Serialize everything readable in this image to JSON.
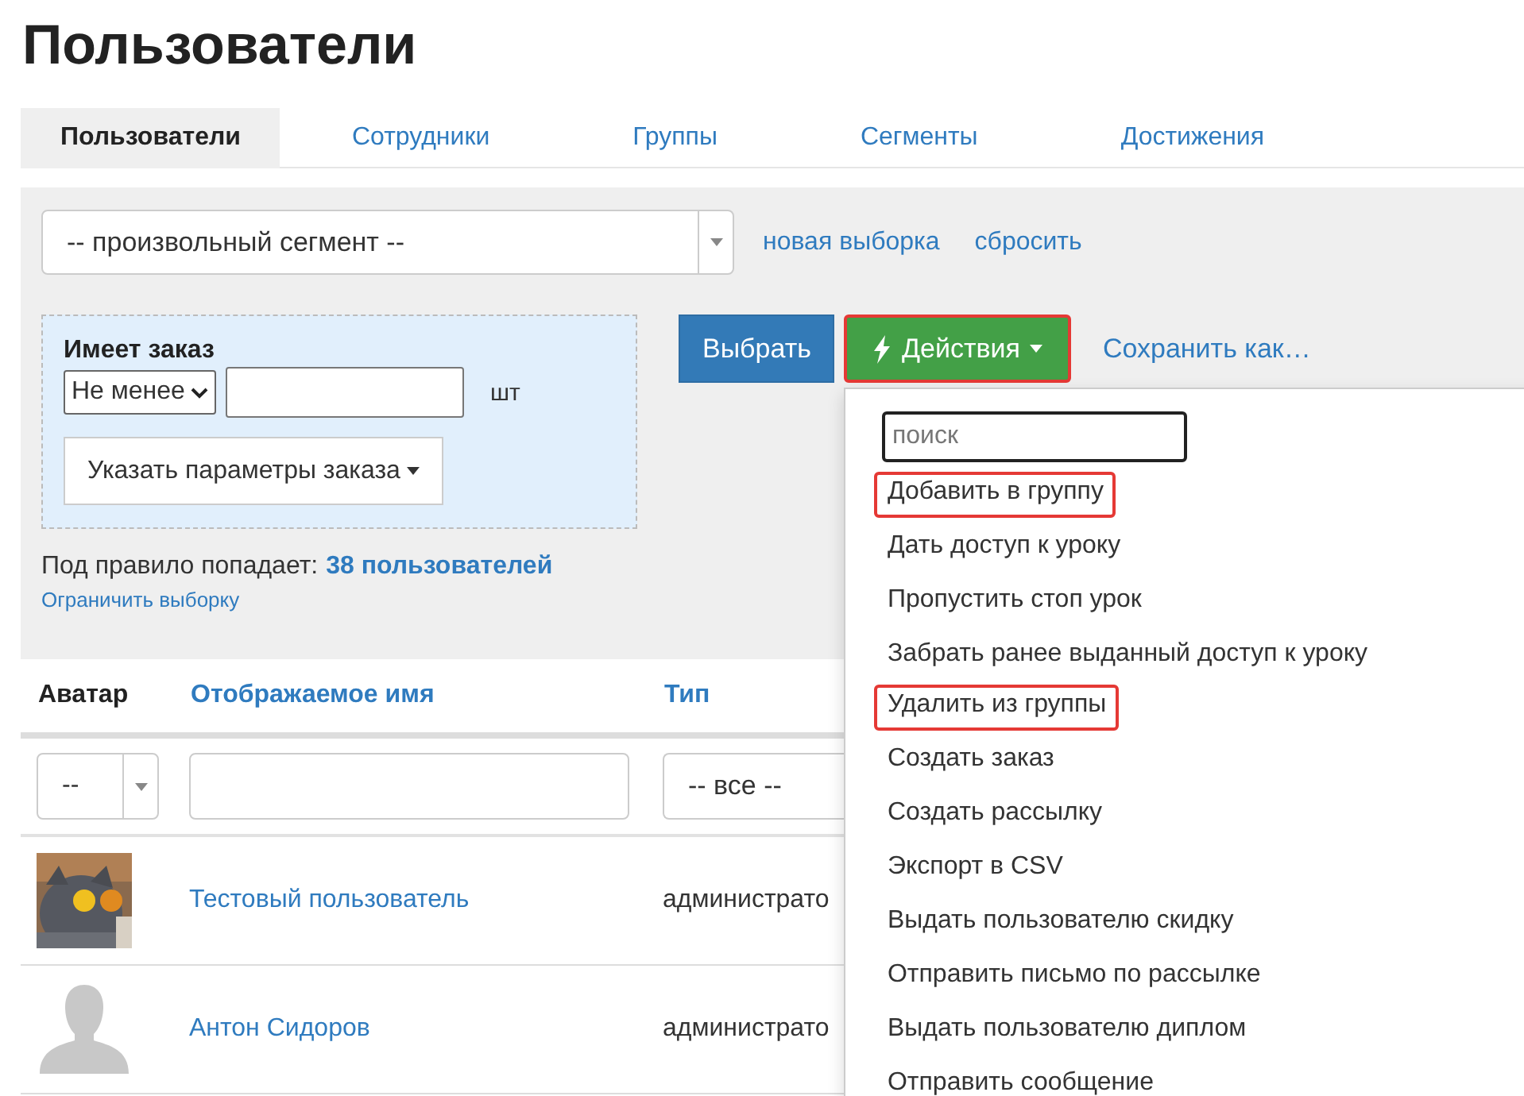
{
  "page_title": "Пользователи",
  "tabs": [
    {
      "label": "Пользователи",
      "selected": true
    },
    {
      "label": "Сотрудники",
      "selected": false
    },
    {
      "label": "Группы",
      "selected": false
    },
    {
      "label": "Сегменты",
      "selected": false
    },
    {
      "label": "Достижения",
      "selected": false
    }
  ],
  "segment_select": {
    "value": "-- произвольный сегмент --"
  },
  "segment_links": [
    "новая выборка",
    "сбросить"
  ],
  "filter": {
    "title": "Имеет заказ",
    "comparator": "Не менее",
    "unit": "шт",
    "params_button": "Указать параметры заказа"
  },
  "toolbar": {
    "select_button": "Выбрать",
    "actions_button": {
      "label": "Действия",
      "highlighted": true
    },
    "save_link": "Сохранить как…"
  },
  "match_label": "Под правило попадает:",
  "match_count": "38 пользователей",
  "limit_link": "Ограничить выборку",
  "actions_menu": {
    "search_placeholder": "поиск",
    "items": [
      {
        "label": "Добавить в группу",
        "highlighted": true
      },
      {
        "label": "Дать доступ к уроку",
        "highlighted": false
      },
      {
        "label": "Пропустить стоп урок",
        "highlighted": false
      },
      {
        "label": "Забрать ранее выданный доступ к уроку",
        "highlighted": false
      },
      {
        "label": "Удалить из группы",
        "highlighted": true
      },
      {
        "label": "Создать заказ",
        "highlighted": false
      },
      {
        "label": "Создать рассылку",
        "highlighted": false
      },
      {
        "label": "Экспорт в CSV",
        "highlighted": false
      },
      {
        "label": "Выдать пользователю скидку",
        "highlighted": false
      },
      {
        "label": "Отправить письмо по рассылке",
        "highlighted": false
      },
      {
        "label": "Выдать пользователю диплом",
        "highlighted": false
      },
      {
        "label": "Отправить сообщение",
        "highlighted": false
      }
    ]
  },
  "table": {
    "columns": [
      {
        "label": "Аватар",
        "sortable": false
      },
      {
        "label": "Отображаемое имя",
        "sortable": true
      },
      {
        "label": "Тип",
        "sortable": true
      }
    ],
    "filters": {
      "avatar": "--",
      "type": "-- все --"
    },
    "rows": [
      {
        "name": "Тестовый пользователь",
        "type": "администрато"
      },
      {
        "kind": "placeholder",
        "name": "Антон Сидоров",
        "type": "администрато"
      }
    ]
  }
}
